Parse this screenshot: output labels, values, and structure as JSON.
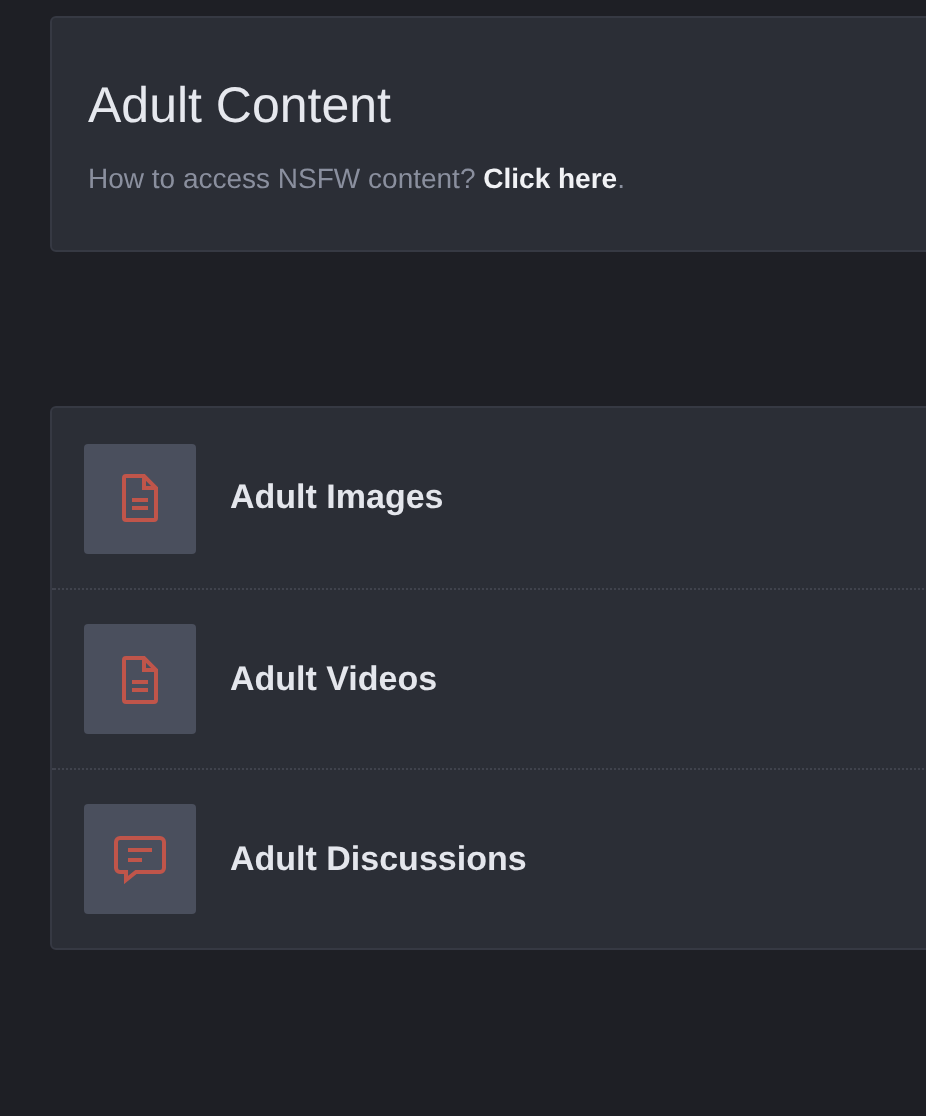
{
  "header": {
    "title": "Adult Content",
    "question": "How to access NSFW content?",
    "link": "Click here",
    "after_link": "."
  },
  "categories": [
    {
      "label": "Adult Images",
      "kind": "document"
    },
    {
      "label": "Adult Videos",
      "kind": "document"
    },
    {
      "label": "Adult Discussions",
      "kind": "chat"
    }
  ]
}
